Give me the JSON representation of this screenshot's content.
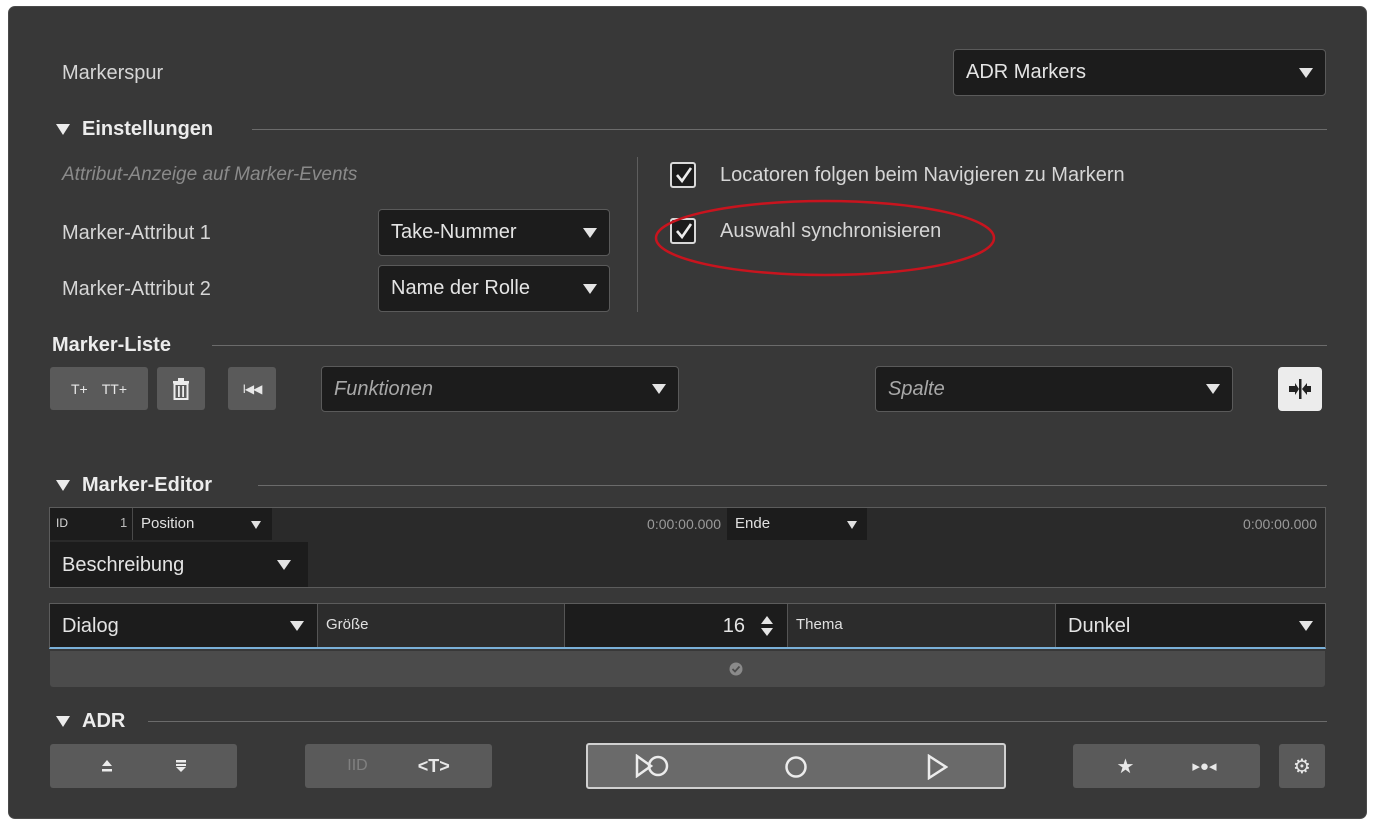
{
  "marker_track": {
    "label": "Markerspur",
    "value": "ADR Markers"
  },
  "settings": {
    "title": "Einstellungen",
    "attr_heading": "Attribut-Anzeige auf Marker-Events",
    "attr1_label": "Marker-Attribut 1",
    "attr1_value": "Take-Nummer",
    "attr2_label": "Marker-Attribut 2",
    "attr2_value": "Name der Rolle",
    "checkbox1_label": "Locatoren folgen beim Navigieren zu Markern",
    "checkbox1_checked": true,
    "checkbox2_label": "Auswahl synchronisieren",
    "checkbox2_checked": true,
    "highlight_color": "#c8141e"
  },
  "marker_list": {
    "title": "Marker-Liste",
    "functions_placeholder": "Funktionen",
    "column_placeholder": "Spalte"
  },
  "marker_editor": {
    "title": "Marker-Editor",
    "id_label": "ID",
    "id_value": "1",
    "position_label": "Position",
    "position_value": "0:00:00.000",
    "end_label": "Ende",
    "end_value": "0:00:00.000",
    "description_label": "Beschreibung",
    "font_value": "Dialog",
    "size_label": "Größe",
    "size_value": "16",
    "theme_label": "Thema",
    "theme_value": "Dunkel"
  },
  "adr": {
    "title": "ADR"
  },
  "colors": {
    "panel": "#383838",
    "field": "#1c1c1c",
    "accent_line": "#7ab0d8"
  }
}
